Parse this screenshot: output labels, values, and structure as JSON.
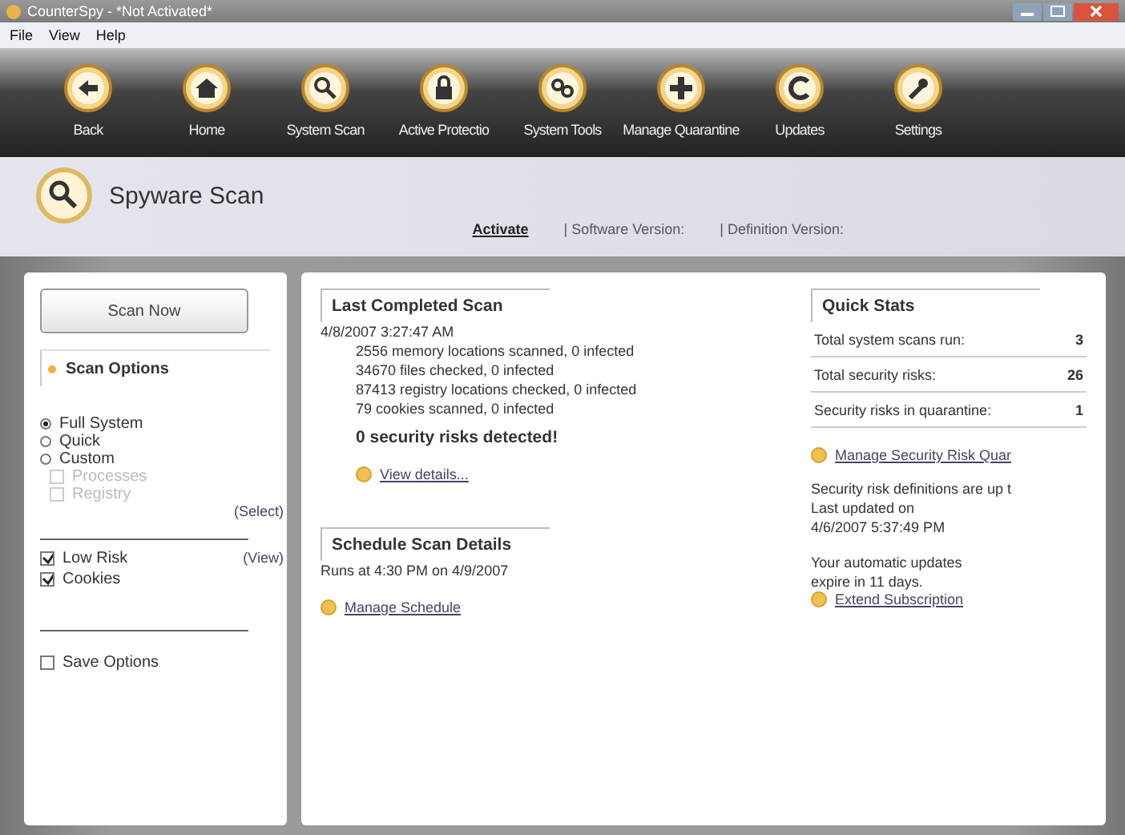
{
  "window": {
    "title": "CounterSpy - *Not Activated*"
  },
  "menu": [
    "File",
    "View",
    "Help"
  ],
  "toolbar": [
    {
      "label": "Back",
      "kind": "back"
    },
    {
      "label": "Home",
      "kind": "home"
    },
    {
      "label": "System Scan",
      "kind": "search"
    },
    {
      "label": "Active Protectio",
      "kind": "lock"
    },
    {
      "label": "System Tools",
      "kind": "tools"
    },
    {
      "label": "Manage Quarantine",
      "kind": "plus"
    },
    {
      "label": "Updates",
      "kind": "refresh"
    },
    {
      "label": "Settings",
      "kind": "wrench"
    }
  ],
  "header": {
    "title": "Spyware Scan",
    "activate": "Activate",
    "links": [
      "| Software Version:",
      "| Definition Version:"
    ]
  },
  "left": {
    "scan_button": "Scan Now",
    "options_title": "Scan Options",
    "scan_types": [
      {
        "label": "Full System",
        "selected": true
      },
      {
        "label": "Quick",
        "selected": false
      },
      {
        "label": "Custom",
        "selected": false
      }
    ],
    "custom_items": [
      {
        "label": "Processes",
        "checked": false,
        "disabled": true
      },
      {
        "label": "Registry",
        "checked": false,
        "disabled": true
      }
    ],
    "select_link": "(Select)",
    "extras": [
      {
        "label": "Low Risk",
        "checked": true
      },
      {
        "label": "Cookies",
        "checked": true
      }
    ],
    "view_link": "(View)",
    "save_options": {
      "label": "Save Options",
      "checked": false
    }
  },
  "last_scan": {
    "title": "Last Completed Scan",
    "date": "4/8/2007 3:27:47 AM",
    "lines": [
      "2556 memory locations scanned, 0 infected",
      "34670 files checked, 0 infected",
      "87413 registry locations checked, 0 infected",
      "79 cookies scanned, 0 infected"
    ],
    "result": "0 security risks detected!",
    "link": "View details..."
  },
  "schedule": {
    "title": "Schedule Scan Details",
    "text": "Runs at 4:30 PM on 4/9/2007",
    "link": "Manage Schedule"
  },
  "quick_stats": {
    "title": "Quick Stats",
    "stats": [
      {
        "label": "Total system scans run:",
        "value": "3"
      },
      {
        "label": "Total security risks:",
        "value": "26"
      },
      {
        "label": "Security risks in quarantine:",
        "value": "1"
      }
    ],
    "link": "Manage Security Risk Quar",
    "definitions": [
      "Security risk definitions are up t",
      "Last updated on",
      "4/6/2007 5:37:49 PM"
    ],
    "expiry": [
      "Your automatic updates",
      "expire in 11 days."
    ],
    "extend_link": "Extend Subscription"
  }
}
